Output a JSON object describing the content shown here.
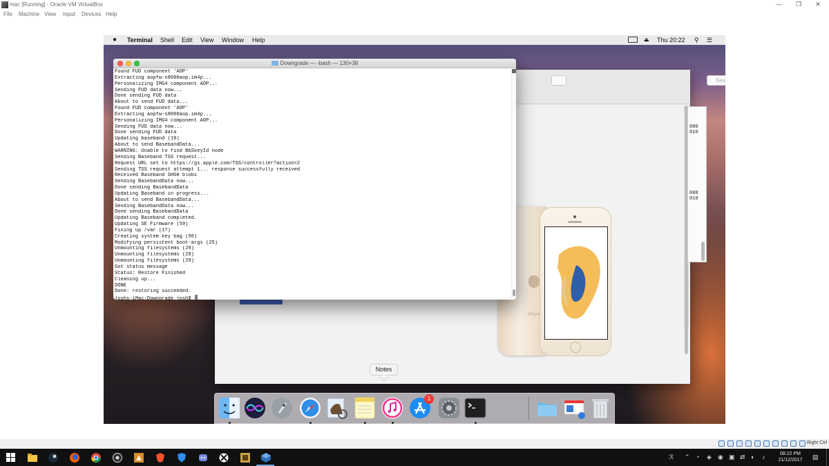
{
  "host": {
    "window_title": "mac [Running] - Oracle VM VirtualBox",
    "menu": [
      "File",
      "Machine",
      "View",
      "Input",
      "Devices",
      "Help"
    ],
    "controls": {
      "minimize": "—",
      "restore": "❐",
      "close": "✕"
    },
    "host_key": "Right Ctrl"
  },
  "mac": {
    "menubar": {
      "apple": "",
      "app": "Terminal",
      "items": [
        "Shell",
        "Edit",
        "View",
        "Window",
        "Help"
      ],
      "clock": "Thu 20:22"
    },
    "finder": {
      "search_placeholder": "Search",
      "phone_model_text": "iPhone"
    },
    "terminal": {
      "title": "Downgrade — -bash — 130×38",
      "lines": [
        "Found FUD component 'AOP'",
        "Extracting aopfw-s8000aop.im4p...",
        "Personalizing IMG4 component AOP...",
        "Sending FUD data now...",
        "Done sending FUD data",
        "About to send FUD data...",
        "Found FUD component 'AOP'",
        "Extracting aopfw-s8000aop.im4p...",
        "Personalizing IMG4 component AOP...",
        "Sending FUD data now...",
        "Done sending FUD data",
        "Updating baseband (19)",
        "About to send BasebandData...",
        "WARNING: Unable to find BbSkeyId node",
        "Sending Baseband TSS request...",
        "Request URL set to https://gs.apple.com/TSS/controller?action=2",
        "Sending TSS request attempt 1... response successfully received",
        "Received Baseband SHSH blobs",
        "Sending BasebandData now...",
        "Done sending BasebandData",
        "Updating Baseband in progress...",
        "About to send BasebandData...",
        "Sending BasebandData now...",
        "Done sending BasebandData",
        "Updating Baseband completed.",
        "Updating SE Firmware (59)",
        "Fixing up /var (17)",
        "Creating system key bag (50)",
        "Modifying persistent boot-args (25)",
        "Unmounting filesystems (29)",
        "Unmounting filesystems (29)",
        "Unmounting filesystems (29)",
        "Got status message",
        "Status: Restore Finished",
        "Cleaning up...",
        "DONE",
        "Done: restoring succeeded."
      ],
      "prompt": "joshs-iMac:Downgrade josh$ "
    },
    "right_terminal_lines": [
      "000",
      "010",
      "000",
      "010"
    ],
    "dock": {
      "tooltip": "Notes",
      "apps": [
        {
          "name": "Finder",
          "icon": "finder-icon",
          "running": true
        },
        {
          "name": "Siri",
          "icon": "siri-icon",
          "running": false
        },
        {
          "name": "Launchpad",
          "icon": "launchpad-icon",
          "running": false
        },
        {
          "name": "Safari",
          "icon": "safari-icon",
          "running": true
        },
        {
          "name": "Preview",
          "icon": "preview-icon",
          "running": false
        },
        {
          "name": "Notes",
          "icon": "notes-icon",
          "running": true
        },
        {
          "name": "iTunes",
          "icon": "itunes-icon",
          "running": true
        },
        {
          "name": "App Store",
          "icon": "app-store-icon",
          "running": false,
          "badge": "1"
        },
        {
          "name": "System Preferences",
          "icon": "system-preferences-icon",
          "running": false
        },
        {
          "name": "Terminal",
          "icon": "terminal-icon",
          "running": true
        },
        {
          "name": "Downloads",
          "icon": "folder-icon",
          "running": false
        },
        {
          "name": "Preview document",
          "icon": "document-icon",
          "running": false
        },
        {
          "name": "Trash",
          "icon": "trash-icon",
          "running": false
        }
      ]
    }
  },
  "windows_taskbar": {
    "apps": [
      "start-icon",
      "file-explorer-icon",
      "steam-icon",
      "firefox-icon",
      "chrome-icon",
      "obs-icon",
      "game-icon",
      "brave-icon",
      "security-icon",
      "discord-icon",
      "xbox-icon",
      "tool-icon",
      "virtualbox-icon"
    ],
    "tray": {
      "time": "08:22 PM",
      "date": "21/12/2017"
    }
  },
  "colors": {
    "accent": "#3b5fb3",
    "badge": "#ee3b36"
  }
}
